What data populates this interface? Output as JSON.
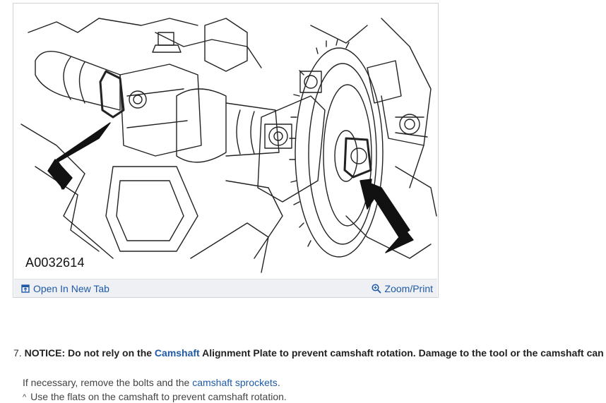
{
  "figure": {
    "image_id": "A0032614",
    "open_tab_label": "Open In New Tab",
    "zoom_print_label": "Zoom/Print",
    "open_tab_icon": "open-in-new-tab-icon",
    "zoom_icon": "zoom-magnifier-icon"
  },
  "step": {
    "number": "7.",
    "notice_label": "NOTICE:",
    "text_before_link": " Do not rely on the ",
    "link_text": "Camshaft",
    "text_after_link": " Alignment Plate to prevent camshaft rotation. Damage to the tool or the camshaft can occur."
  },
  "instruction": {
    "text_before_link": "If necessary, remove the bolts and the ",
    "link_text": "camshaft sprockets",
    "text_after_link": "."
  },
  "sub_bullet": {
    "marker": "^",
    "text": "Use the flats on the camshaft to prevent camshaft rotation."
  },
  "colors": {
    "link": "#1f5aa6",
    "toolbar_bg": "#eef0f3",
    "frame_border": "#cfd3d8"
  }
}
